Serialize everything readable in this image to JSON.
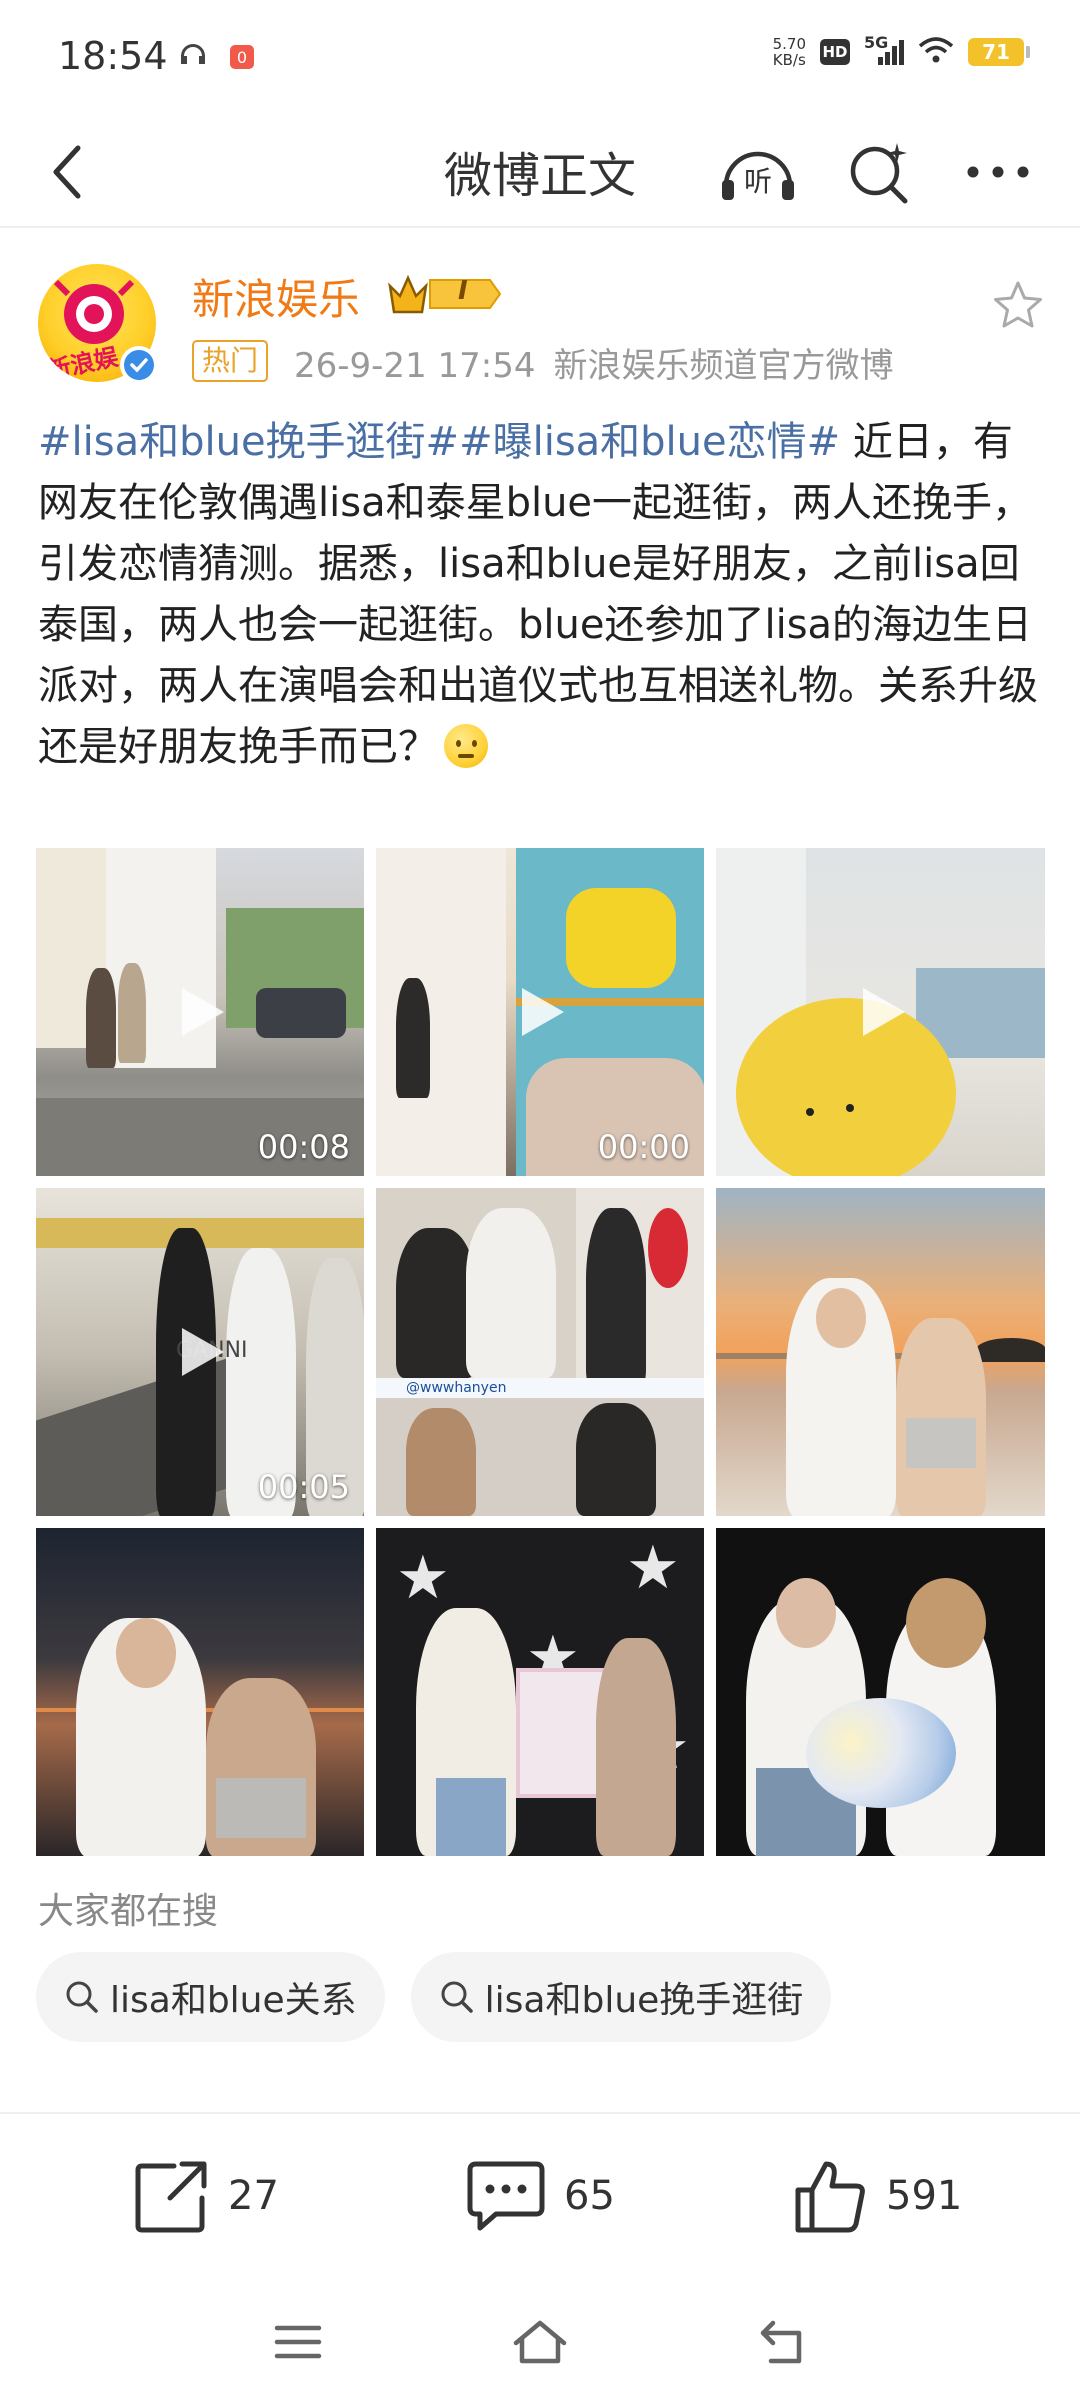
{
  "status_bar": {
    "time": "18:54",
    "net_speed_value": "5.70",
    "net_speed_unit": "KB/s",
    "hd_label": "HD",
    "signal_label": "5G",
    "battery": "71",
    "notification_badge": "0"
  },
  "nav": {
    "title": "微博正文",
    "listen_label": "听"
  },
  "post": {
    "username": "新浪娱乐",
    "level_badge": "I",
    "avatar_text": "新浪娱",
    "hot_tag": "热门",
    "timestamp": "26-9-21 17:54",
    "source": "新浪娱乐频道官方微博",
    "hashtag_1": "#lisa和blue挽手逛街#",
    "hashtag_2": "#曝lisa和blue恋情#",
    "body": " 近日，有网友在伦敦偶遇lisa和泰星blue一起逛街，两人还挽手，引发恋情猜测。据悉，lisa和blue是好朋友，之前lisa回泰国，两人也会一起逛街。blue还参加了lisa的海边生日派对，两人在演唱会和出道仪式也互相送礼物。关系升级还是好朋友挽手而已？"
  },
  "media": [
    {
      "type": "video",
      "duration": "00:08",
      "overlay": ""
    },
    {
      "type": "video",
      "duration": "00:00",
      "overlay": ""
    },
    {
      "type": "video",
      "duration": "",
      "overlay": ""
    },
    {
      "type": "video",
      "duration": "00:05",
      "overlay": "GANNI"
    },
    {
      "type": "image",
      "duration": "",
      "overlay": "@wwwhanyen"
    },
    {
      "type": "image",
      "duration": "",
      "overlay": ""
    },
    {
      "type": "image",
      "duration": "",
      "overlay": ""
    },
    {
      "type": "image",
      "duration": "",
      "overlay": ""
    },
    {
      "type": "image",
      "duration": "",
      "overlay": ""
    }
  ],
  "search": {
    "title": "大家都在搜",
    "chips": [
      "lisa和blue关系",
      "lisa和blue挽手逛街"
    ]
  },
  "actions": {
    "share_count": "27",
    "comment_count": "65",
    "like_count": "591"
  },
  "colors": {
    "username": "#f07b16",
    "hashtag": "#4a6fa5",
    "hot_tag": "#e9a22a",
    "meta": "#999999"
  }
}
